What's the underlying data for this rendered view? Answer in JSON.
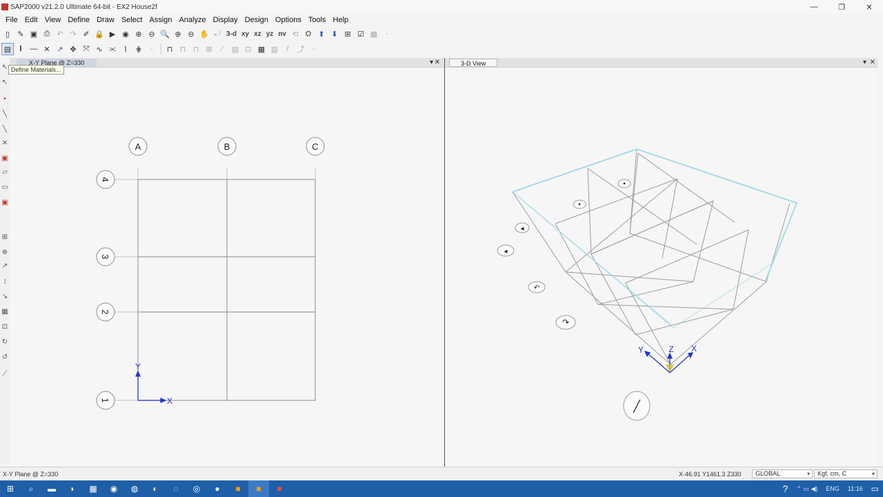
{
  "window": {
    "title": "SAP2000 v21.2.0 Ultimate 64-bit - EX2 House2f",
    "minimize": "—",
    "restore": "❐",
    "close": "✕"
  },
  "menu": [
    "File",
    "Edit",
    "View",
    "Define",
    "Draw",
    "Select",
    "Assign",
    "Analyze",
    "Display",
    "Design",
    "Options",
    "Tools",
    "Help"
  ],
  "toolbar": {
    "view_3d": "3-d",
    "view_xy": "xy",
    "view_xz": "xz",
    "view_yz": "yz",
    "view_nv": "nv"
  },
  "tooltip": "Define Materials...",
  "left_pane": {
    "tab": "X-Y Plane @ Z=330",
    "grid_columns": [
      "A",
      "B",
      "C"
    ],
    "grid_rows": [
      "4",
      "3",
      "2",
      "1"
    ],
    "axis_x": "X",
    "axis_y": "Y"
  },
  "right_pane": {
    "tab": "3-D View",
    "axis_x": "X",
    "axis_y": "Y",
    "axis_z": "Z"
  },
  "status": {
    "plane": "X-Y Plane @ Z=330",
    "coords": "X-46.91  Y1461.3  Z330",
    "coord_system": "GLOBAL",
    "units": "Kgf, cm, C"
  },
  "taskbar": {
    "tray_lang": "ENG",
    "tray_time": "11:16"
  },
  "colors": {
    "title_bar": "#f7f7f7",
    "pane_bg": "#f6f6f6",
    "grid_line": "#bdbdbd",
    "frame_line": "#9a9a9a",
    "top_edge": "#a8dde8",
    "axis_blue": "#2233cc",
    "taskbar": "#1e5fa8"
  }
}
